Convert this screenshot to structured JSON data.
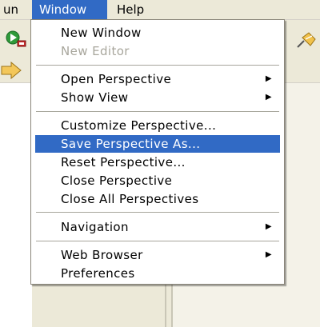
{
  "menubar": {
    "items": [
      {
        "label": "un"
      },
      {
        "label": "Window"
      },
      {
        "label": "Help"
      }
    ]
  },
  "toolbar": {
    "icons": [
      "run-icon",
      "pin-icon",
      "forward-arrow-icon"
    ]
  },
  "window_menu": {
    "items": [
      {
        "label": "New Window",
        "enabled": true
      },
      {
        "label": "New Editor",
        "enabled": false
      },
      {
        "label": "Open Perspective",
        "submenu": true
      },
      {
        "label": "Show View",
        "submenu": true
      },
      {
        "label": "Customize Perspective..."
      },
      {
        "label": "Save Perspective As...",
        "selected": true
      },
      {
        "label": "Reset Perspective..."
      },
      {
        "label": "Close Perspective"
      },
      {
        "label": "Close All Perspectives"
      },
      {
        "label": "Navigation",
        "submenu": true
      },
      {
        "label": "Web Browser",
        "submenu": true
      },
      {
        "label": "Preferences"
      }
    ],
    "submenu_arrow": "▶"
  },
  "colors": {
    "selection": "#316ac5",
    "menu_bg": "#ffffff",
    "chrome_bg": "#ece9d8",
    "disabled_text": "#a8a69c"
  }
}
